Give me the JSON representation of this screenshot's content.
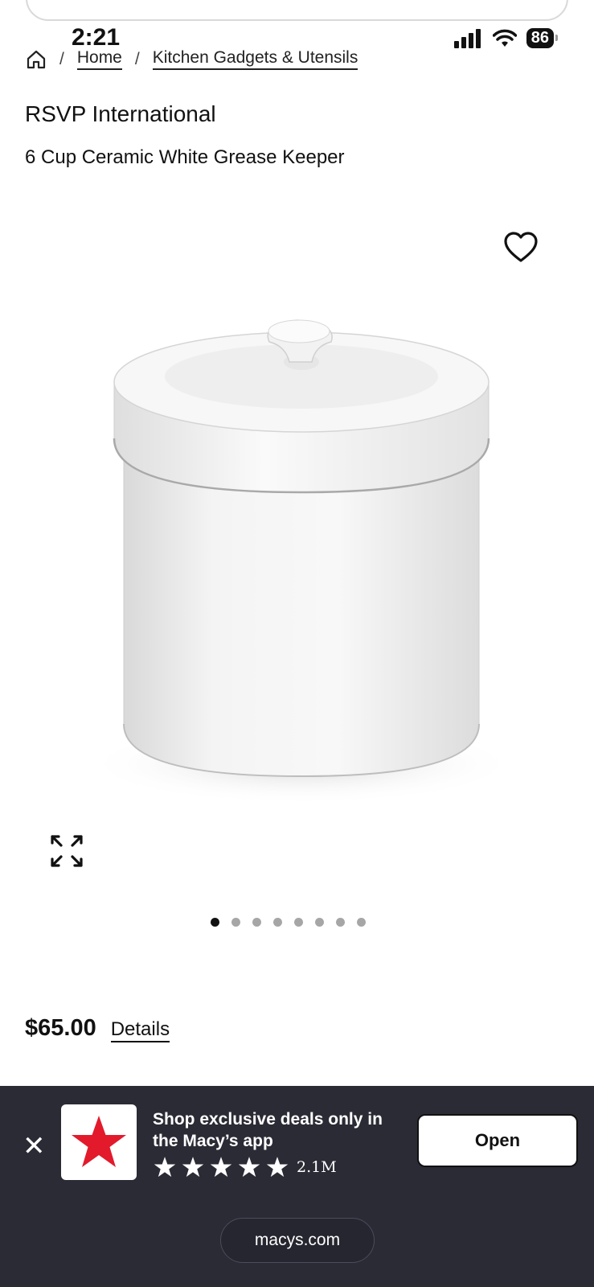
{
  "status_bar": {
    "time": "2:21",
    "battery": "86"
  },
  "breadcrumb": {
    "home_label": "Home",
    "category_label": "Kitchen Gadgets & Utensils"
  },
  "product": {
    "brand": "RSVP International",
    "name": "6 Cup Ceramic White Grease Keeper",
    "price": "$65.00",
    "details_label": "Details",
    "image_count": 8,
    "active_image_index": 0
  },
  "app_banner": {
    "promo_text": "Shop exclusive deals only in the Macy’s app",
    "rating_count": "2.1M",
    "rating_stars": 5,
    "open_label": "Open",
    "url": "macys.com"
  },
  "icons": {
    "home": "home-icon",
    "heart": "heart-icon",
    "expand": "expand-icon",
    "close": "close-icon",
    "star": "star-icon",
    "signal": "signal-icon",
    "wifi": "wifi-icon"
  },
  "colors": {
    "brand_red": "#e21a2c",
    "banner_bg": "#2b2b36"
  }
}
